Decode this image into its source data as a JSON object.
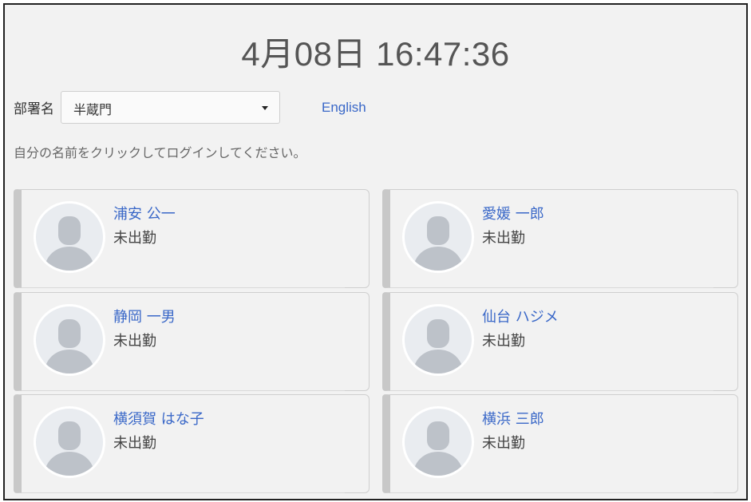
{
  "clock": {
    "text": "4月08日 16:47:36"
  },
  "department": {
    "label": "部署名",
    "selected": "半蔵門"
  },
  "language_link": "English",
  "instruction": "自分の名前をクリックしてログインしてください。",
  "employees": [
    {
      "name": "浦安 公一",
      "status": "未出勤"
    },
    {
      "name": "愛媛 一郎",
      "status": "未出勤"
    },
    {
      "name": "静岡 一男",
      "status": "未出勤"
    },
    {
      "name": "仙台 ハジメ",
      "status": "未出勤"
    },
    {
      "name": "横須賀 はな子",
      "status": "未出勤"
    },
    {
      "name": "横浜 三郎",
      "status": "未出勤"
    }
  ],
  "icons": {
    "avatar": "user-silhouette-icon",
    "dropdown": "caret-down-icon"
  },
  "colors": {
    "accent_link": "#3a68c8",
    "background": "#f2f2f2",
    "card_border_left": "#c8c8c8",
    "avatar_silhouette": "#bdc2c9"
  }
}
